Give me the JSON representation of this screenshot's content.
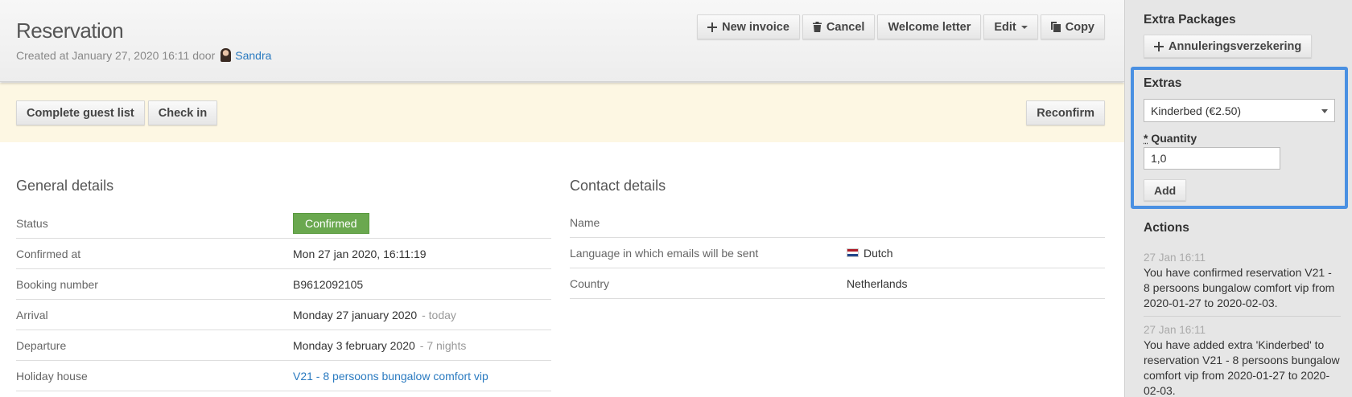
{
  "header": {
    "title": "Reservation",
    "created_prefix": "Created at January 27, 2020 16:11 door",
    "created_user": "Sandra"
  },
  "toolbar": {
    "new_invoice": "New invoice",
    "cancel": "Cancel",
    "welcome_letter": "Welcome letter",
    "edit": "Edit",
    "copy": "Copy"
  },
  "actionbar": {
    "complete_guest_list": "Complete guest list",
    "check_in": "Check in",
    "reconfirm": "Reconfirm"
  },
  "general": {
    "title": "General details",
    "rows": [
      {
        "key": "Status",
        "value": "Confirmed"
      },
      {
        "key": "Confirmed at",
        "value": "Mon 27 jan 2020, 16:11:19"
      },
      {
        "key": "Booking number",
        "value": "B9612092105"
      },
      {
        "key": "Arrival",
        "value": "Monday 27 january 2020",
        "note": "- today"
      },
      {
        "key": "Departure",
        "value": "Monday 3 february 2020",
        "note": "- 7 nights"
      },
      {
        "key": "Holiday house",
        "value": "V21 - 8 persoons bungalow comfort vip"
      }
    ]
  },
  "contact": {
    "title": "Contact details",
    "rows": [
      {
        "key": "Name",
        "value": ""
      },
      {
        "key": "Language in which emails will be sent",
        "value": "Dutch"
      },
      {
        "key": "Country",
        "value": "Netherlands"
      }
    ]
  },
  "sidebar": {
    "extra_packages_title": "Extra Packages",
    "annulering_button": "Annuleringsverzekering",
    "extras_title": "Extras",
    "extras_selected": "Kinderbed (€2.50)",
    "quantity_required_mark": "*",
    "quantity_label": "Quantity",
    "quantity_value": "1,0",
    "add_button": "Add",
    "actions_title": "Actions",
    "actions": [
      {
        "time": "27 Jan 16:11",
        "text": "You have confirmed reservation V21 - 8 persoons bungalow comfort vip from 2020-01-27 to 2020-02-03."
      },
      {
        "time": "27 Jan 16:11",
        "text": "You have added extra 'Kinderbed' to reservation V21 - 8 persoons bungalow comfort vip from 2020-01-27 to 2020-02-03."
      }
    ]
  },
  "colors": {
    "accent_link": "#2a7ac0",
    "confirmed_badge": "#6aa84f",
    "focus_border": "#4a90e2",
    "action_bar_bg": "#fdf7e3"
  }
}
